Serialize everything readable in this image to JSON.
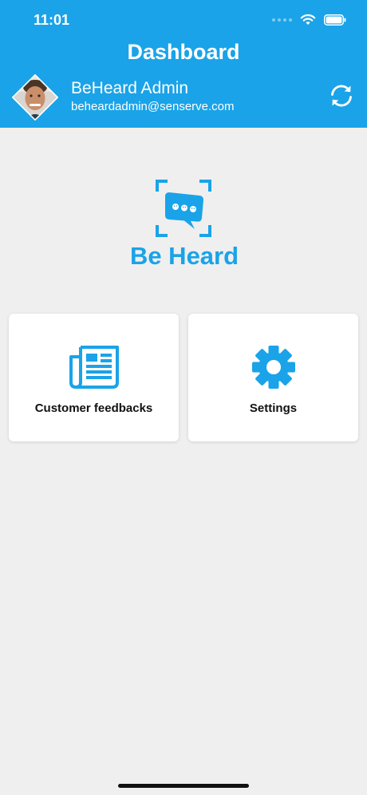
{
  "status_bar": {
    "time": "11:01"
  },
  "header": {
    "title": "Dashboard",
    "user_name": "BeHeard Admin",
    "user_email": "beheardadmin@senserve.com"
  },
  "logo": {
    "text": "Be Heard"
  },
  "cards": [
    {
      "label": "Customer feedbacks",
      "icon": "newspaper-icon"
    },
    {
      "label": "Settings",
      "icon": "gear-icon"
    }
  ],
  "colors": {
    "accent": "#1aa3e8",
    "background": "#efefef",
    "card": "#ffffff"
  }
}
